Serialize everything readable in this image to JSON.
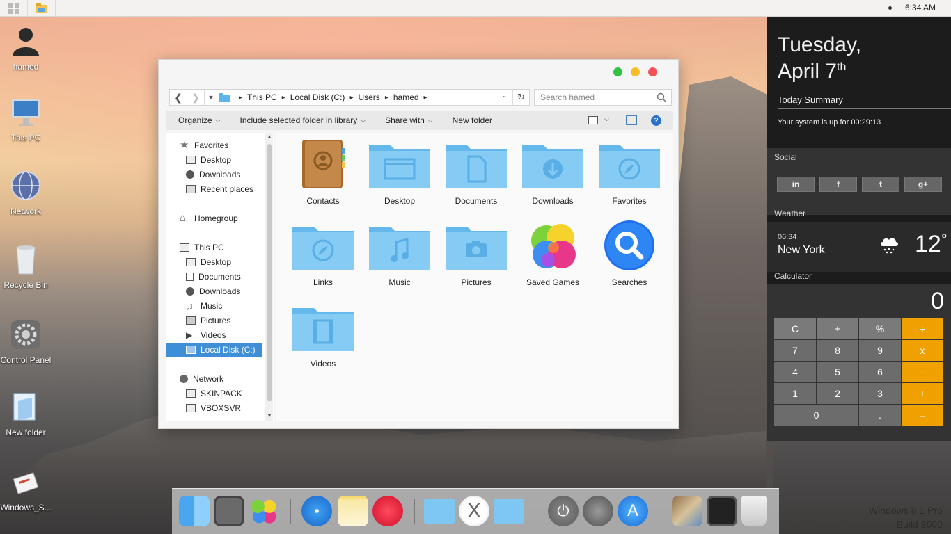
{
  "topbar": {
    "clock": "6:34 AM"
  },
  "desktop_icons": [
    {
      "label": "hamed",
      "icon": "user-icon"
    },
    {
      "label": "This PC",
      "icon": "imac-icon"
    },
    {
      "label": "Network",
      "icon": "network-globe-icon"
    },
    {
      "label": "Recycle Bin",
      "icon": "trash-icon"
    },
    {
      "label": "Control Panel",
      "icon": "gear-icon"
    },
    {
      "label": "New folder",
      "icon": "folder-icon"
    },
    {
      "label": "Windows_S...",
      "icon": "installer-icon"
    }
  ],
  "explorer": {
    "breadcrumb": [
      "This PC",
      "Local Disk (C:)",
      "Users",
      "hamed"
    ],
    "search_placeholder": "Search hamed",
    "toolbar": {
      "organize": "Organize",
      "include": "Include selected folder in library",
      "share": "Share with",
      "new_folder": "New folder"
    },
    "nav": {
      "favorites": "Favorites",
      "fav_desktop": "Desktop",
      "fav_downloads": "Downloads",
      "fav_recent": "Recent places",
      "homegroup": "Homegroup",
      "thispc": "This PC",
      "pc_desktop": "Desktop",
      "pc_documents": "Documents",
      "pc_downloads": "Downloads",
      "pc_music": "Music",
      "pc_pictures": "Pictures",
      "pc_videos": "Videos",
      "pc_localdisk": "Local Disk (C:)",
      "network": "Network",
      "net_skinpack": "SKINPACK",
      "net_vboxsvr": "VBOXSVR"
    },
    "items": [
      {
        "label": "Contacts",
        "icon": "contacts-book-icon"
      },
      {
        "label": "Desktop",
        "icon": "folder-desktop-icon"
      },
      {
        "label": "Documents",
        "icon": "folder-documents-icon"
      },
      {
        "label": "Downloads",
        "icon": "folder-downloads-icon"
      },
      {
        "label": "Favorites",
        "icon": "folder-favorites-icon"
      },
      {
        "label": "Links",
        "icon": "folder-links-icon"
      },
      {
        "label": "Music",
        "icon": "folder-music-icon"
      },
      {
        "label": "Pictures",
        "icon": "folder-pictures-icon"
      },
      {
        "label": "Saved Games",
        "icon": "game-center-icon"
      },
      {
        "label": "Searches",
        "icon": "search-magnifier-icon"
      },
      {
        "label": "Videos",
        "icon": "folder-videos-icon"
      }
    ]
  },
  "panel": {
    "weekday": "Tuesday,",
    "date": "April 7",
    "date_suffix": "th",
    "summary_title": "Today Summary",
    "uptime": "Your system is up for 00:29:13",
    "social_label": "Social",
    "social": [
      "in",
      "f",
      "t",
      "g+"
    ],
    "weather_label": "Weather",
    "weather_time": "06:34",
    "weather_city": "New York",
    "weather_temp": "12",
    "weather_unit": "°",
    "calculator_label": "Calculator",
    "calc_display": "0",
    "calc_keys": [
      [
        "C",
        "±",
        "%",
        "÷"
      ],
      [
        "7",
        "8",
        "9",
        "x"
      ],
      [
        "4",
        "5",
        "6",
        "-"
      ],
      [
        "1",
        "2",
        "3",
        "+"
      ],
      [
        "0",
        ".",
        "="
      ]
    ]
  },
  "dock_apps": [
    "finder-icon",
    "system-preferences-icon",
    "game-center-icon",
    "safari-icon",
    "notes-icon",
    "itunes-icon",
    "folder-icon",
    "osx-x-icon",
    "folder-apps-icon",
    "power-icon",
    "launchpad-icon",
    "app-store-icon",
    "preview-icon",
    "photo-booth-icon",
    "trash-icon"
  ],
  "watermark": {
    "line1": "Windows 8.1 Pro",
    "line2": "Build 9600"
  },
  "colors": {
    "accent": "#3f8fd8",
    "folder_blue": "#7ec7f2",
    "calc_operator": "#f0a100",
    "panel_bg": "#1c1c1c"
  }
}
